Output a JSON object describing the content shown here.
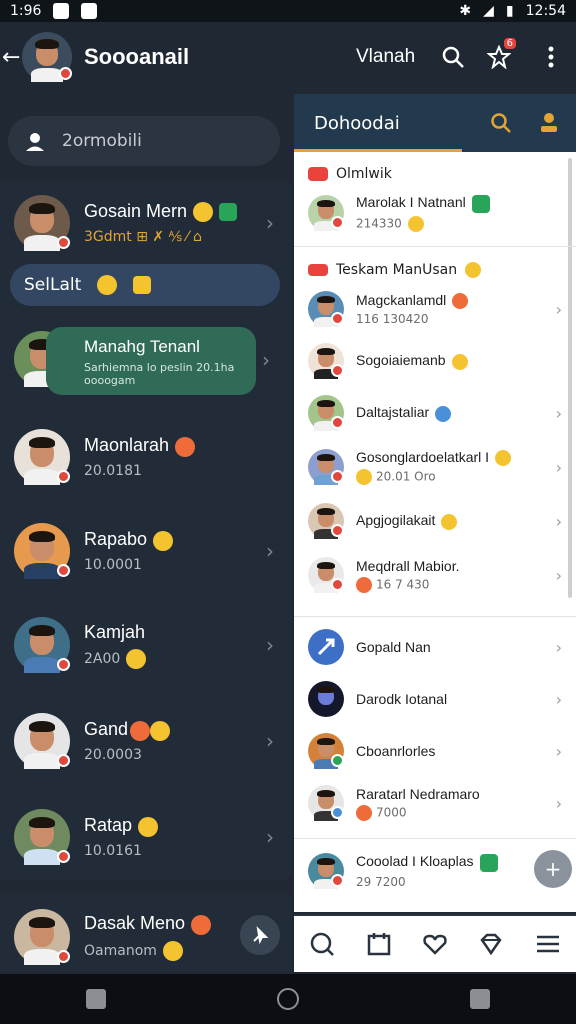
{
  "status_bar": {
    "time_left": "1:96",
    "time_right": "12:54"
  },
  "app_bar": {
    "title": "Soooanail",
    "right_name": "Vlanah",
    "notification_count": "6"
  },
  "left_search": {
    "placeholder": "2ormobili"
  },
  "left_select": {
    "label": "SelLalt"
  },
  "left_chats": [
    {
      "name": "Gosain Mern",
      "sub": "3Gdmt ⊞ ✗ ⅍ ⁄ ⌂"
    },
    {
      "name": "Manahg Tenanl",
      "sub": "Sarhiemna lo peslin 20.1ha oooogam"
    },
    {
      "name": "Maonlarah",
      "sub": "20.0181"
    },
    {
      "name": "Rapabo",
      "sub": "10.0001"
    },
    {
      "name": "Kamjah",
      "sub": "2A00"
    },
    {
      "name": "Gand",
      "sub": "20.0003"
    },
    {
      "name": "Ratap",
      "sub": "10.0161"
    },
    {
      "name": "Dasak Meno",
      "sub": "Oamanom"
    }
  ],
  "right_panel": {
    "header": "Dohoodai",
    "section1": "Olmlwik",
    "section1_item": {
      "name": "Marolak I Natnanl",
      "sub": "214330"
    },
    "section2": "Teskam ManUsan",
    "rows": [
      {
        "name": "Magckanlamdl",
        "sub": "116 130420"
      },
      {
        "name": "Sogoiaiemanb",
        "sub": ""
      },
      {
        "name": "Daltajstaliar",
        "sub": ""
      },
      {
        "name": "Gosonglardoelatkarl I",
        "sub": "20.01 Oro"
      },
      {
        "name": "Apgjogilakait",
        "sub": ""
      },
      {
        "name": "Meqdrall Mabior.",
        "sub": "16 7 430"
      }
    ],
    "rows2": [
      {
        "name": "Gopald Nan",
        "sub": ""
      },
      {
        "name": "Darodk Iotanal",
        "sub": ""
      },
      {
        "name": "Cboanrlorles",
        "sub": ""
      },
      {
        "name": "Raratarl Nedramaro",
        "sub": "7000"
      },
      {
        "name": "Cooolad I Kloaplas",
        "sub": "29 7200"
      }
    ]
  },
  "colors": {
    "bg": "#1f2833",
    "accent": "#e3a434",
    "bubble": "#2f6b57",
    "panel": "#ffffff"
  }
}
